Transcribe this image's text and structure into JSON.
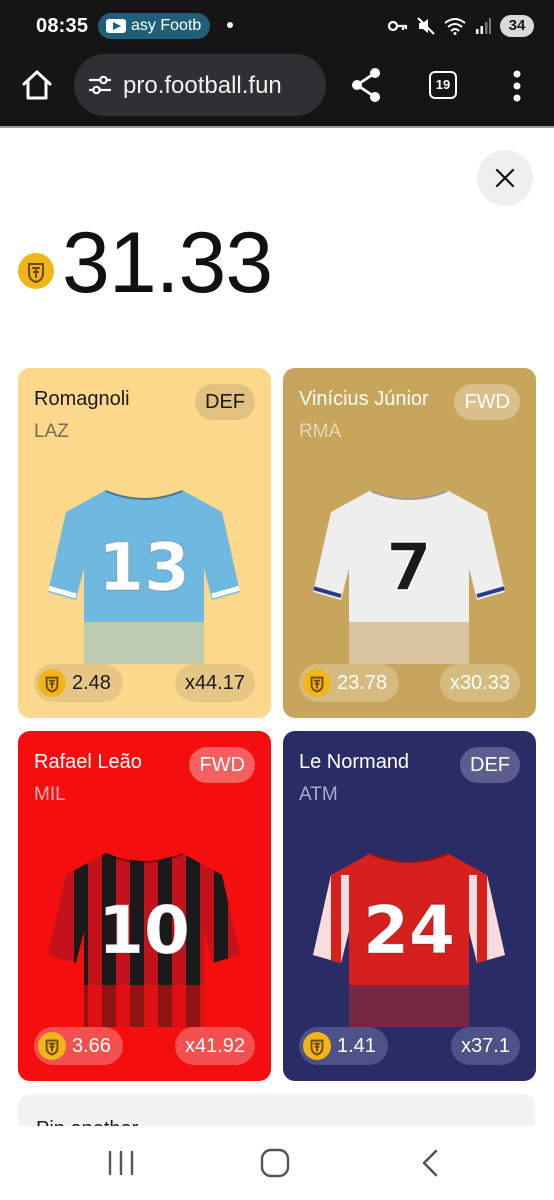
{
  "status_bar": {
    "time": "08:35",
    "notification_text": "asy Footb",
    "battery": "34"
  },
  "browser": {
    "url": "pro.football.fun",
    "tab_count": "19"
  },
  "score": "31.33",
  "cards": [
    {
      "name": "Romagnoli",
      "team": "LAZ",
      "position": "DEF",
      "stat": "2.48",
      "multiplier": "x44.17",
      "shirt_number": "13",
      "shirt_color": "#6fb9e0"
    },
    {
      "name": "Vinícius Júnior",
      "team": "RMA",
      "position": "FWD",
      "stat": "23.78",
      "multiplier": "x30.33",
      "shirt_number": "7",
      "shirt_color": "#eeeeee"
    },
    {
      "name": "Rafael Leão",
      "team": "MIL",
      "position": "FWD",
      "stat": "3.66",
      "multiplier": "x41.92",
      "shirt_number": "10",
      "shirt_color": "#c4121c"
    },
    {
      "name": "Le Normand",
      "team": "ATM",
      "position": "DEF",
      "stat": "1.41",
      "multiplier": "x37.1",
      "shirt_number": "24",
      "shirt_color": "#d6201e"
    }
  ],
  "bottom_panel_text": "Pin another",
  "colors": {
    "coin": "#f2b517",
    "card_laz": "#fcd88c",
    "card_rma": "#c8a55c",
    "card_mil": "#f40e0e",
    "card_atm": "#2a2d65"
  }
}
